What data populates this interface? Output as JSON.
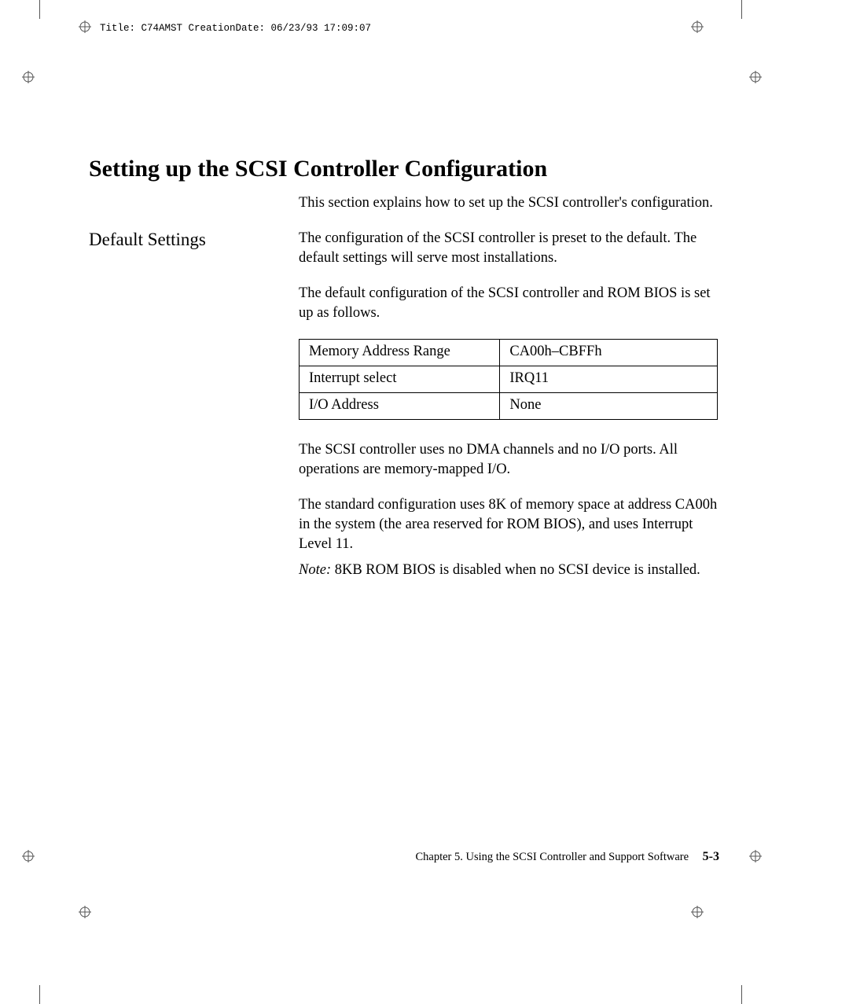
{
  "meta_header": "Title: C74AMST CreationDate: 06/23/93 17:09:07",
  "heading": "Setting up the SCSI Controller Configuration",
  "intro": "This section explains how to set up the SCSI controller's configuration.",
  "subheading": "Default Settings",
  "para1": "The configuration of the SCSI controller is preset to the default.  The default settings will serve most installations.",
  "para2": "The default configuration of the SCSI controller and ROM BIOS is set up as follows.",
  "table": {
    "rows": [
      {
        "label": "Memory Address Range",
        "value": "CA00h–CBFFh"
      },
      {
        "label": "Interrupt select",
        "value": "IRQ11"
      },
      {
        "label": "I/O Address",
        "value": "None"
      }
    ]
  },
  "para3": "The SCSI controller uses no DMA channels and no I/O ports.  All operations are memory-mapped I/O.",
  "para4": "The standard configuration uses 8K of memory space at address CA00h in the system (the area reserved for ROM BIOS), and uses Interrupt Level 11.",
  "note_label": "Note:  ",
  "note_text": "8KB ROM BIOS is disabled when no SCSI device is installed.",
  "footer_chapter": "Chapter 5.  Using the SCSI Controller and Support Software",
  "footer_page": "5-3"
}
